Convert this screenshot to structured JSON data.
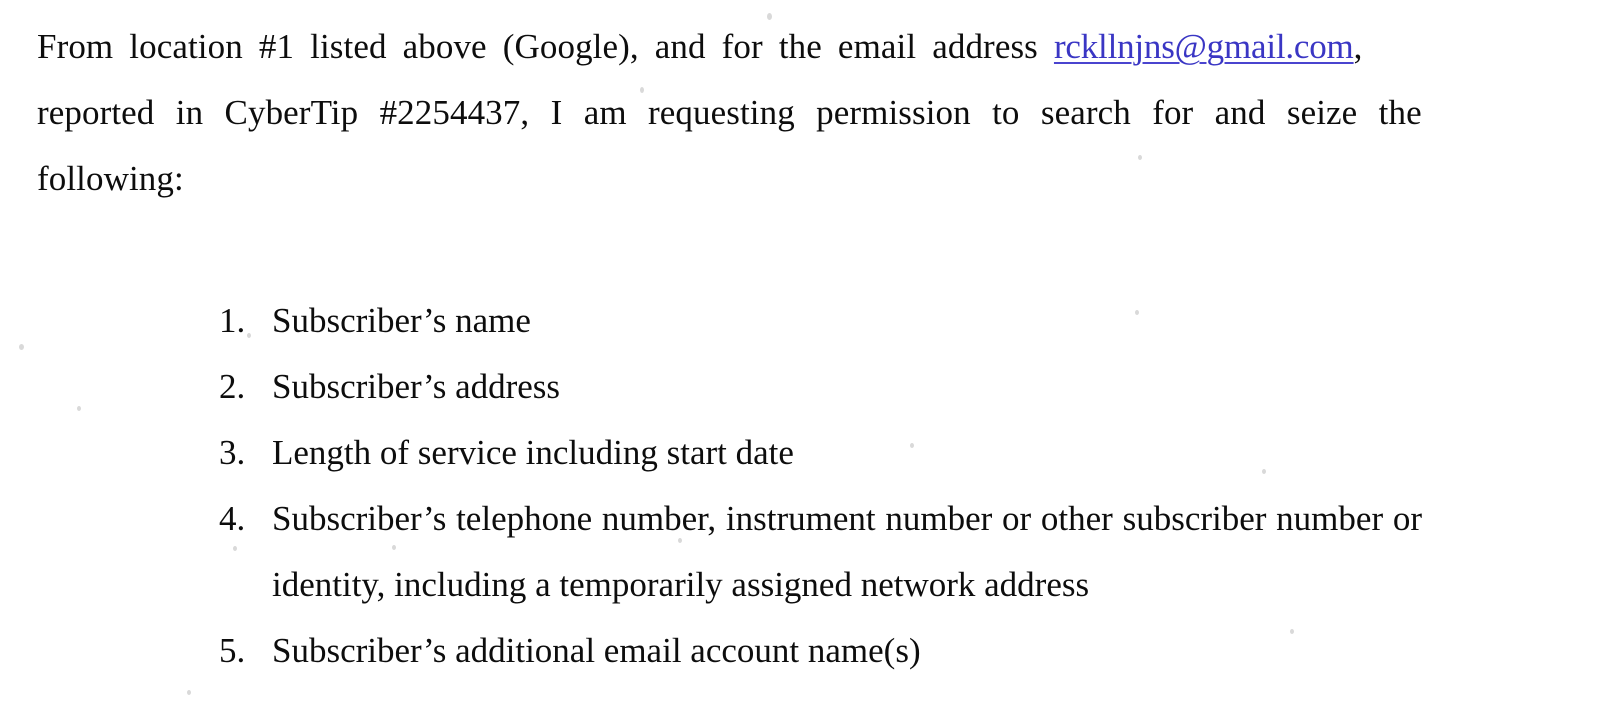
{
  "document": {
    "type": "scanned-legal-affidavit-page",
    "background_color": "#ffffff",
    "text_color": "#0d0d0d",
    "link_color": "#3a36c4"
  },
  "intro": {
    "line1_before_link": "From location #1 listed above (Google), and for the email address",
    "email_link": "rckllnjns@gmail.com",
    "line1_after_link": ",",
    "line2": "reported in CyberTip #2254437, I am requesting permission to search for and seize the",
    "line3": "following:",
    "cybertip_number": "#2254437",
    "location_number": "#1",
    "provider": "Google"
  },
  "list": {
    "items": [
      {
        "number": "1.",
        "lines": [
          "Subscriber’s name"
        ]
      },
      {
        "number": "2.",
        "lines": [
          "Subscriber’s address"
        ]
      },
      {
        "number": "3.",
        "lines": [
          "Length of service including start date"
        ]
      },
      {
        "number": "4.",
        "lines": [
          "Subscriber’s telephone number, instrument number or other subscriber number or",
          "identity, including a temporarily assigned network address"
        ]
      },
      {
        "number": "5.",
        "lines": [
          "Subscriber’s additional email account name(s)"
        ]
      }
    ]
  }
}
